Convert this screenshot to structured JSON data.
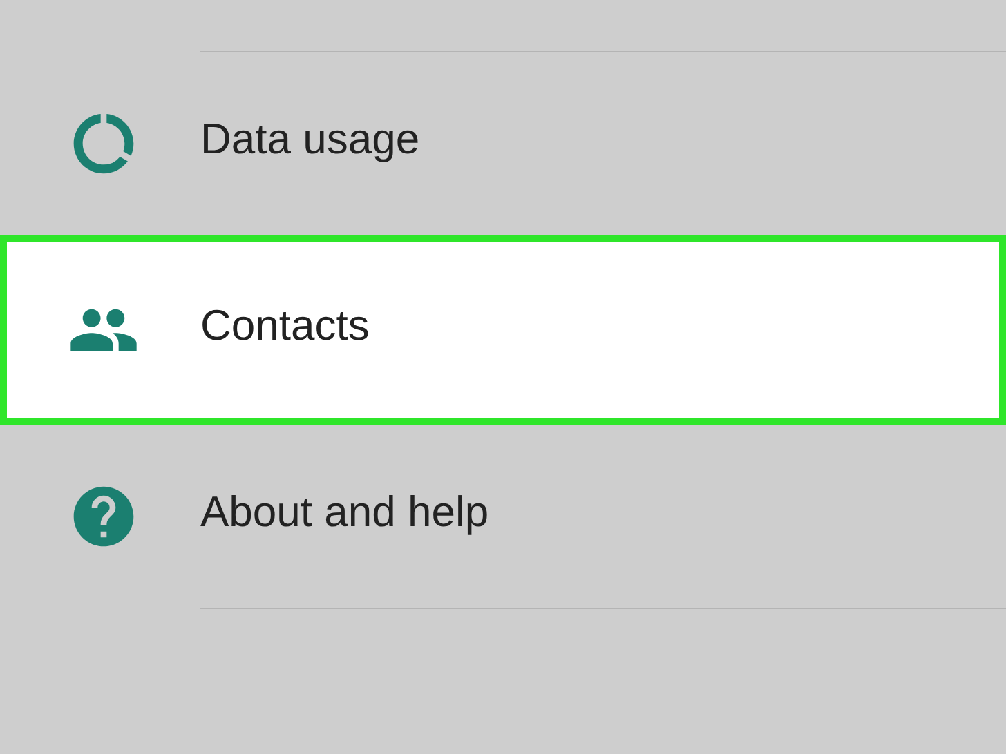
{
  "settings_items": [
    {
      "kind": "data",
      "label": "Data usage",
      "selected": false
    },
    {
      "kind": "contacts",
      "label": "Contacts",
      "selected": true
    },
    {
      "kind": "help",
      "label": "About and help",
      "selected": false
    }
  ]
}
